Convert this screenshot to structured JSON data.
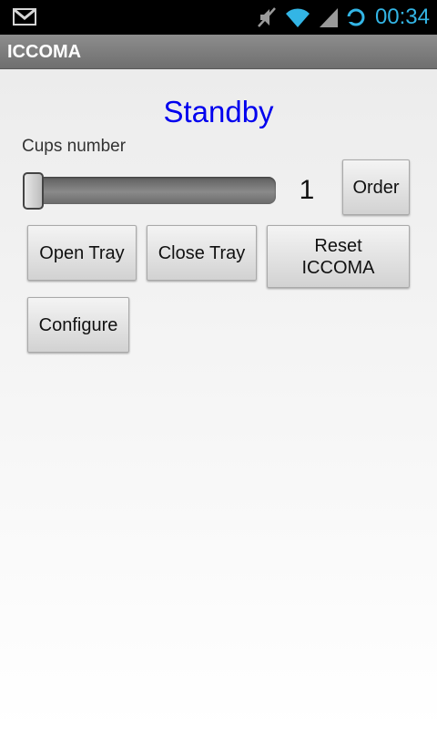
{
  "status_bar": {
    "time": "00:34",
    "icons": [
      "gmail-icon",
      "mute-icon",
      "wifi-icon",
      "signal-icon",
      "sync-icon"
    ]
  },
  "app": {
    "title": "ICCOMA"
  },
  "main": {
    "status": "Standby",
    "cups_label": "Cups number",
    "cups_value": "1",
    "slider_fraction": 0.0,
    "buttons": {
      "order": "Order",
      "open_tray": "Open Tray",
      "close_tray": "Close Tray",
      "reset": "Reset\nICCOMA",
      "configure": "Configure"
    }
  },
  "colors": {
    "status_text": "#0000ee",
    "status_bar_accent": "#33b5e5"
  }
}
